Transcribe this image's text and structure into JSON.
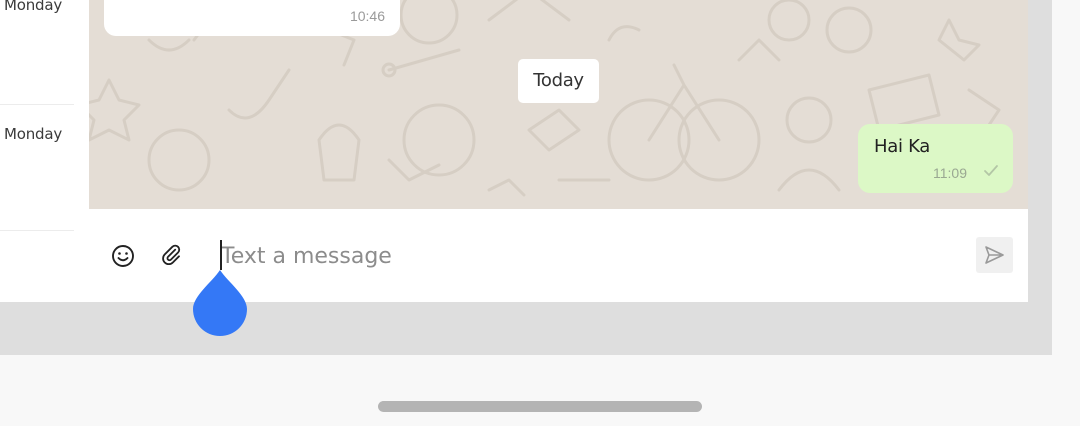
{
  "sidebar": {
    "items": [
      {
        "time": "Monday"
      },
      {
        "time": "Monday"
      },
      {
        "time": ""
      }
    ]
  },
  "chat": {
    "previous_message": {
      "time": "10:46"
    },
    "date_divider": "Today",
    "outgoing_message": {
      "text": "Hai Ka",
      "time": "11:09",
      "status_icon": "single-check-icon"
    }
  },
  "composer": {
    "placeholder": "Text a message",
    "value": "",
    "icons": [
      "smiley-icon",
      "paperclip-icon",
      "send-icon"
    ]
  },
  "colors": {
    "chat_background": "#e4ddd5",
    "outgoing_bubble": "#dcf8c6",
    "text_cursor_handle": "#3478f6"
  }
}
